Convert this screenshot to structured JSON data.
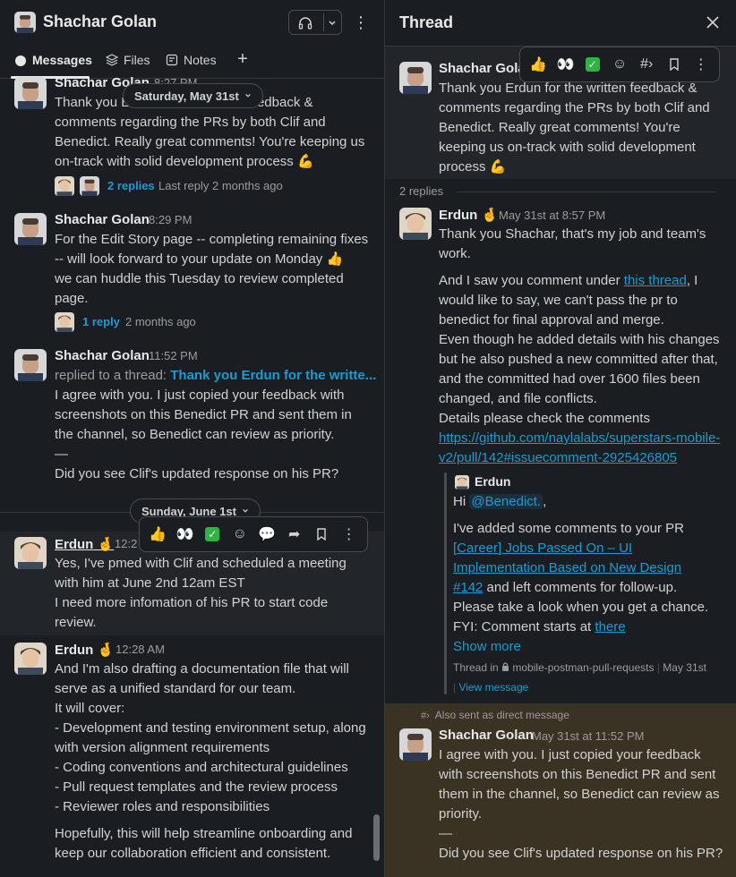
{
  "left": {
    "header": {
      "title": "Shachar Golan"
    },
    "tabs": [
      {
        "label": "Messages"
      },
      {
        "label": "Files"
      },
      {
        "label": "Notes"
      }
    ],
    "messages": [
      {
        "author": "Shachar Golan",
        "time": "8:27 PM",
        "lines": [
          "Thank you Erdun for the written feedback &",
          "comments regarding the PRs by both Clif and",
          "Benedict. Really great comments! You're keeping us",
          "on-track with solid development process 💪"
        ],
        "replies_label": "2 replies",
        "replies_meta": "Last reply 2 months ago"
      },
      {
        "author": "Shachar Golan",
        "time": "8:29 PM",
        "lines": [
          "For the Edit Story page -- completing remaining fixes",
          "-- will look forward to your update on Monday 👍",
          "we can huddle this Tuesday to review completed",
          "page."
        ],
        "replies_label": "1 reply",
        "replies_meta": "2 months ago"
      },
      {
        "author": "Shachar Golan",
        "time": "11:52 PM",
        "replied_prefix": "replied to a thread:",
        "replied_link": "Thank you Erdun for the writte...",
        "lines": [
          "I agree with you. I just copied your feedback with",
          "screenshots on this Benedict PR and sent them in",
          "the channel, so Benedict can review as priority.",
          "—",
          "Did you see Clif's updated response on his PR?"
        ]
      },
      {
        "author": "Erdun",
        "emoji": "🤞",
        "time": "12:2",
        "lines": [
          "Yes, I've pmed with Clif and scheduled a meeting",
          "with him at June 2nd 12am EST",
          "I need more infomation of his PR to start code",
          "review."
        ]
      },
      {
        "author": "Erdun",
        "emoji": "🤞",
        "time": "12:28 AM",
        "lines": [
          "And I'm also drafting a documentation file that will",
          "serve as a unified standard for our team.",
          "It will cover:",
          "- Development and testing environment setup, along",
          "with version alignment requirements",
          "- Coding conventions and architectural guidelines",
          "- Pull request templates and the review process",
          "- Reviewer roles and responsibilities"
        ],
        "lines2": [
          "Hopefully, this will help streamline onboarding and",
          "keep our collaboration efficient and consistent."
        ]
      }
    ],
    "date_pills": [
      "Saturday, May 31st",
      "Sunday, June 1st"
    ]
  },
  "right": {
    "header": {
      "title": "Thread"
    },
    "parent": {
      "author": "Shachar Golan",
      "lines": [
        "Thank you Erdun for the written feedback &",
        "comments regarding the PRs by both Clif and",
        "Benedict. Really great comments! You're",
        "keeping us on-track with solid development",
        "process 💪"
      ]
    },
    "replies_count": "2 replies",
    "reply1": {
      "author": "Erdun",
      "emoji": "🤞",
      "time": "May 31st at 8:57 PM",
      "p1": [
        "Thank you Shachar, that's my job and team's",
        "work."
      ],
      "p2_prefix": "And I saw you comment under ",
      "p2_link": "this thread",
      "p2_suffix": ", I",
      "p2": [
        "would like to say, we can't pass the pr to",
        "benedict for final approval and merge.",
        "Even though he added details with his changes",
        "but he also pushed a new committed after that,",
        "and the committed had over 1600 files been",
        "changed, and file conflicts.",
        "Details please check the comments"
      ],
      "url_lines": [
        "https://github.com/naylalabs/superstars-mobile-",
        "v2/pull/142#issuecomment-2925426805"
      ],
      "quote": {
        "author": "Erdun",
        "greeting": "Hi ",
        "mention": "@Benedict.",
        "greeting_suffix": ",",
        "line1": "I've added some comments to your PR",
        "pr_link_lines": [
          "[Career] Jobs Passed On – UI",
          "Implementation Based on New Design",
          "#142"
        ],
        "pr_suffix": " and left comments for follow-up.",
        "line3": "Please take a look when you get a chance.",
        "fyi_prefix": "FYI: Comment starts at ",
        "fyi_link": "there",
        "show_more": "Show more",
        "meta_prefix": "Thread in",
        "meta_channel": "mobile-postman-pull-requests",
        "meta_date": "May 31st",
        "view_message": "View message"
      }
    },
    "reply2": {
      "also_sent": "Also sent as direct message",
      "author": "Shachar Golan",
      "time": "May 31st at 11:52 PM",
      "lines": [
        "I agree with you. I just copied your feedback",
        "with screenshots on this Benedict PR and sent",
        "them in the channel, so Benedict can review as",
        "priority.",
        "—",
        "Did you see Clif's updated response on his PR?"
      ]
    }
  },
  "colors": {
    "background": "#1a1d21",
    "link": "#1d9bd1",
    "highlight": "#3a3223",
    "hover": "#222529"
  }
}
